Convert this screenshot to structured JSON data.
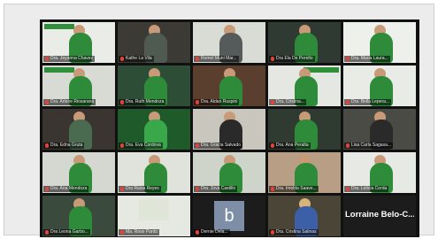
{
  "gallery": {
    "avatar_letter": "b",
    "big_name": "Lorraine  Belo-C...",
    "tiles": [
      {
        "label": "Dra. Jeyanna Chavez",
        "bg": "#e9ece7"
      },
      {
        "label": "Kathe La Vila",
        "bg": "#3b3a34"
      },
      {
        "label": "Romel Muni Mar...",
        "bg": "#d9dcd5"
      },
      {
        "label": "Dra Ela De Perelto",
        "bg": "#2f3a33"
      },
      {
        "label": "Dra. Maria Laura...",
        "bg": "#eef0ec"
      },
      {
        "label": "Dra. Arlene Riosarana",
        "bg": "#d7dbd3"
      },
      {
        "label": "Dra. Ruth Mendoza",
        "bg": "#2e4d36"
      },
      {
        "label": "Dra. Aldan Ruspini",
        "bg": "#5a3f2f"
      },
      {
        "label": "Dra. Cristina...",
        "bg": "#e5e8e2"
      },
      {
        "label": "Dra. Bella Lepera...",
        "bg": "#e8ebe6"
      },
      {
        "label": "Dra. Edna Gruta",
        "bg": "#3a3530"
      },
      {
        "label": "Dra. Eva Cordova",
        "bg": "#1f5a2b"
      },
      {
        "label": "Dra. Gracia Salvado",
        "bg": "#c9c7bd"
      },
      {
        "label": "Dra. Ana Peralta",
        "bg": "#2f3a30"
      },
      {
        "label": "Lisa Carla Sagasa...",
        "bg": "#4a4b45"
      },
      {
        "label": "Dra. Ana Mendoza",
        "bg": "#d4d8d0"
      },
      {
        "label": "Dra Raisa Reyes",
        "bg": "#dfe3dc"
      },
      {
        "label": "Dra. Jova Castillo",
        "bg": "#cfd4cb"
      },
      {
        "label": "Dra. Imelda Saave...",
        "bg": "#b89e84"
      },
      {
        "label": "Dra. Leticia Cerda",
        "bg": "#e7eae4"
      },
      {
        "label": "Dra Leona Garbo...",
        "bg": "#3a4a3c"
      },
      {
        "label": "Ma. Rose Pardo",
        "bg": "#e6e8e2"
      },
      {
        "label": "Dernie Dela...",
        "bg": ""
      },
      {
        "label": "Dra. Cristina Salinas",
        "bg": "#4a4536"
      }
    ]
  }
}
